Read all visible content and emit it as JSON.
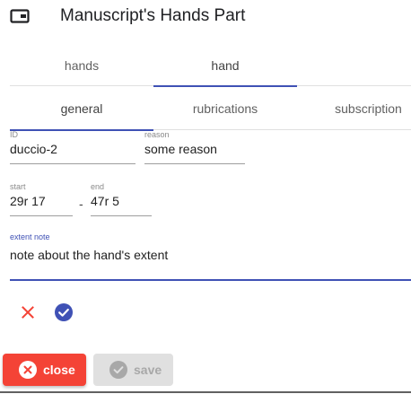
{
  "header": {
    "title": "Manuscript's Hands Part",
    "icon": "window-icon"
  },
  "tabs_primary": [
    {
      "label": "hands",
      "active": false
    },
    {
      "label": "hand",
      "active": true
    }
  ],
  "tabs_secondary": [
    {
      "label": "general",
      "active": true
    },
    {
      "label": "rubrications",
      "active": false
    },
    {
      "label": "subscription",
      "active": false
    }
  ],
  "form": {
    "id": {
      "label": "ID",
      "value": "duccio-2"
    },
    "reason": {
      "label": "reason",
      "value": "some reason"
    },
    "start": {
      "label": "start",
      "value": "29r 17"
    },
    "range_separator": "-",
    "end": {
      "label": "end",
      "value": "47r 5"
    },
    "extent_note": {
      "label": "extent note",
      "value": "note about the hand's extent"
    }
  },
  "actions": {
    "cancel_icon": "close-icon",
    "confirm_icon": "check-circle-icon"
  },
  "buttons": {
    "close_label": "close",
    "save_label": "save"
  },
  "colors": {
    "accent": "#3f51b5",
    "warn": "#f44336",
    "disabled_bg": "#e0e0e0",
    "disabled_text": "#a8a8a8"
  }
}
